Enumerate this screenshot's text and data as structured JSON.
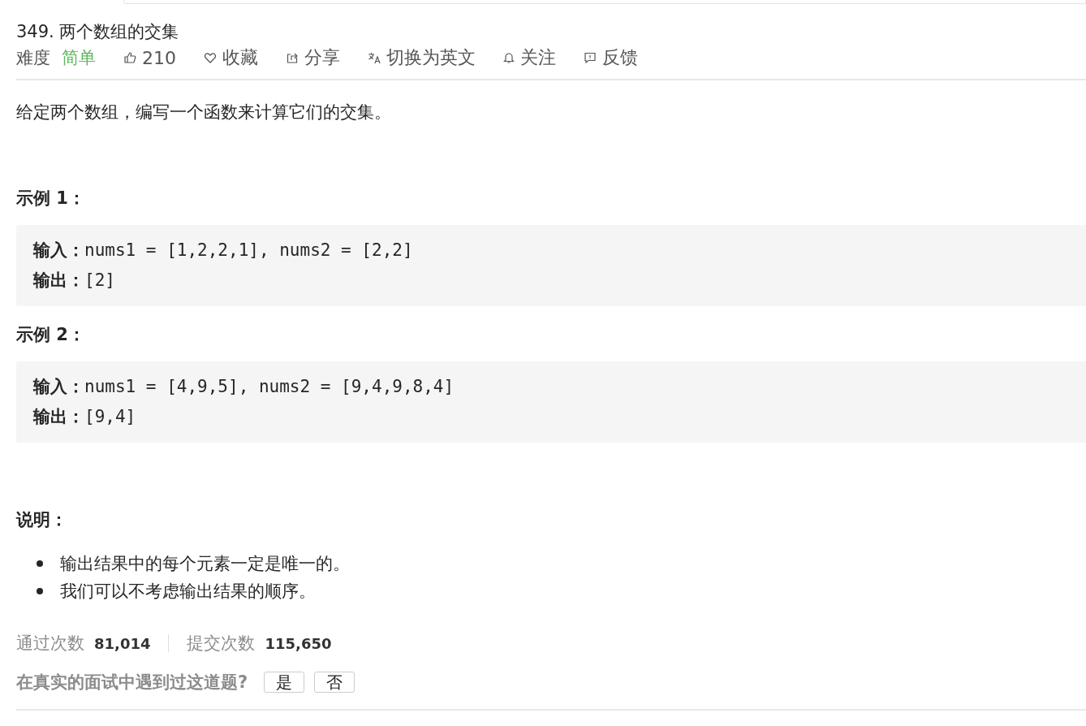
{
  "problem": {
    "title": "349. 两个数组的交集",
    "difficulty_label": "难度",
    "difficulty": "简单",
    "actions": [
      {
        "kind": "like",
        "label": "210"
      },
      {
        "kind": "favorite",
        "label": "收藏"
      },
      {
        "kind": "share",
        "label": "分享"
      },
      {
        "kind": "translate",
        "label": "切换为英文"
      },
      {
        "kind": "follow",
        "label": "关注"
      },
      {
        "kind": "feedback",
        "label": "反馈"
      }
    ]
  },
  "description": "给定两个数组，编写一个函数来计算它们的交集。",
  "examples": [
    {
      "heading": "示例 1：",
      "lines": [
        "**输入：**nums1 = [1,2,2,1], nums2 = [2,2]",
        "**输出：**[2]"
      ]
    },
    {
      "heading": "示例 2：",
      "lines": [
        "**输入：**nums1 = [4,9,5], nums2 = [9,4,9,8,4]",
        "**输出：**[9,4]"
      ]
    }
  ],
  "notes": {
    "heading": "说明：",
    "items": [
      "输出结果中的每个元素一定是唯一的。",
      "我们可以不考虑输出结果的顺序。"
    ]
  },
  "stats": [
    {
      "label": "通过次数",
      "value": "81,014"
    },
    {
      "label": "提交次数",
      "value": "115,650"
    }
  ],
  "interview": {
    "question": "在真实的面试中遇到过这道题?",
    "buttons": [
      "是",
      "否"
    ]
  }
}
